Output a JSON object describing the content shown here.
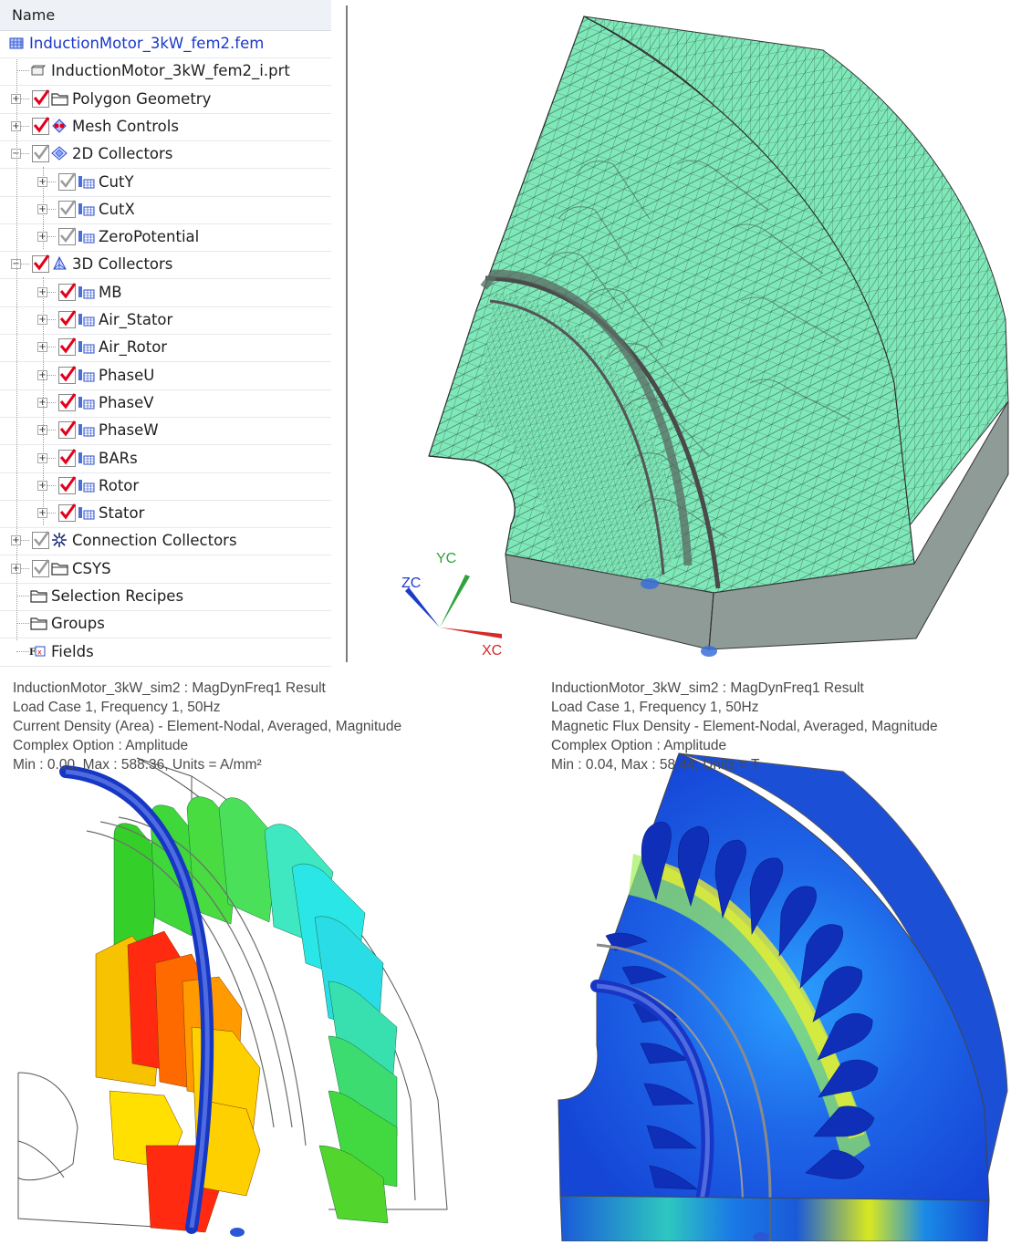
{
  "navigator": {
    "header": "Name",
    "items": [
      {
        "label": "InductionMotor_3kW_fem2.fem",
        "icon": "fem-file-icon",
        "level": 0,
        "checkbox": "none",
        "expander": "none",
        "root": true
      },
      {
        "label": "InductionMotor_3kW_fem2_i.prt",
        "icon": "part-file-icon",
        "level": 1,
        "checkbox": "none",
        "expander": "none"
      },
      {
        "label": "Polygon Geometry",
        "icon": "folder-icon",
        "level": 1,
        "checkbox": "checked",
        "expander": "plus"
      },
      {
        "label": "Mesh Controls",
        "icon": "mesh-controls-icon",
        "level": 1,
        "checkbox": "checked",
        "expander": "plus"
      },
      {
        "label": "2D Collectors",
        "icon": "2d-collector-icon",
        "level": 1,
        "checkbox": "gray",
        "expander": "minus"
      },
      {
        "label": "CutY",
        "icon": "mesh-collector-icon",
        "level": 2,
        "checkbox": "gray",
        "expander": "plus"
      },
      {
        "label": "CutX",
        "icon": "mesh-collector-icon",
        "level": 2,
        "checkbox": "gray",
        "expander": "plus"
      },
      {
        "label": "ZeroPotential",
        "icon": "mesh-collector-icon",
        "level": 2,
        "checkbox": "gray",
        "expander": "plus"
      },
      {
        "label": "3D Collectors",
        "icon": "3d-collector-icon",
        "level": 1,
        "checkbox": "checked",
        "expander": "minus"
      },
      {
        "label": "MB",
        "icon": "mesh-collector-icon",
        "level": 2,
        "checkbox": "checked",
        "expander": "plus"
      },
      {
        "label": "Air_Stator",
        "icon": "mesh-collector-icon",
        "level": 2,
        "checkbox": "checked",
        "expander": "plus"
      },
      {
        "label": "Air_Rotor",
        "icon": "mesh-collector-icon",
        "level": 2,
        "checkbox": "checked",
        "expander": "plus"
      },
      {
        "label": "PhaseU",
        "icon": "mesh-collector-icon",
        "level": 2,
        "checkbox": "checked",
        "expander": "plus"
      },
      {
        "label": "PhaseV",
        "icon": "mesh-collector-icon",
        "level": 2,
        "checkbox": "checked",
        "expander": "plus"
      },
      {
        "label": "PhaseW",
        "icon": "mesh-collector-icon",
        "level": 2,
        "checkbox": "checked",
        "expander": "plus"
      },
      {
        "label": "BARs",
        "icon": "mesh-collector-icon",
        "level": 2,
        "checkbox": "checked",
        "expander": "plus"
      },
      {
        "label": "Rotor",
        "icon": "mesh-collector-icon",
        "level": 2,
        "checkbox": "checked",
        "expander": "plus"
      },
      {
        "label": "Stator",
        "icon": "mesh-collector-icon",
        "level": 2,
        "checkbox": "checked",
        "expander": "plus"
      },
      {
        "label": "Connection Collectors",
        "icon": "connection-collector-icon",
        "level": 1,
        "checkbox": "gray",
        "expander": "plus"
      },
      {
        "label": "CSYS",
        "icon": "folder-icon",
        "level": 1,
        "checkbox": "gray",
        "expander": "plus"
      },
      {
        "label": "Selection Recipes",
        "icon": "folder-icon",
        "level": 1,
        "checkbox": "none",
        "expander": "none"
      },
      {
        "label": "Groups",
        "icon": "folder-icon",
        "level": 1,
        "checkbox": "none",
        "expander": "none"
      },
      {
        "label": "Fields",
        "icon": "fields-icon",
        "level": 1,
        "checkbox": "none",
        "expander": "none"
      }
    ]
  },
  "mesh_view": {
    "triad": {
      "x": "XC",
      "y": "YC",
      "z": "ZC"
    },
    "colors": {
      "mesh": "#7fe8b9",
      "side": "#8f9b97",
      "edge": "#3a3a3a"
    }
  },
  "results": [
    {
      "lines": [
        "InductionMotor_3kW_sim2 : MagDynFreq1 Result",
        "Load Case 1, Frequency 1, 50Hz",
        "Current Density (Area) - Element-Nodal, Averaged, Magnitude",
        "Complex Option : Amplitude",
        "Min : 0.00, Max : 588.36, Units = A/mm²"
      ]
    },
    {
      "lines": [
        "InductionMotor_3kW_sim2 : MagDynFreq1 Result",
        "Load Case 1, Frequency 1, 50Hz",
        "Magnetic Flux Density - Element-Nodal, Averaged, Magnitude",
        "Complex Option : Amplitude",
        "Min : 0.04, Max : 58.44, Units = T"
      ]
    }
  ],
  "colors": {
    "checked_tick": "#e3001b",
    "gray_tick": "#9a9a9a",
    "root_text": "#1a37c9"
  }
}
